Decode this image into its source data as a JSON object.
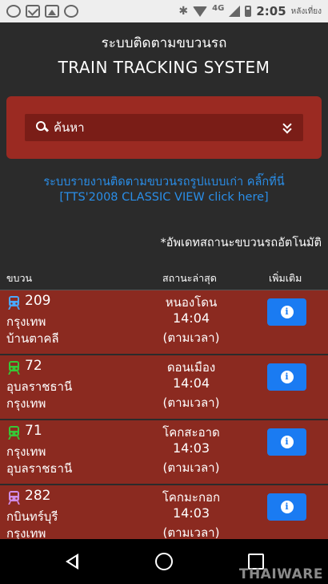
{
  "status_bar": {
    "network": "4G",
    "time": "2:05",
    "period": "หลังเที่ยง"
  },
  "header": {
    "title_th": "ระบบติดตามขบวนรถ",
    "title_en": "TRAIN TRACKING SYSTEM"
  },
  "search": {
    "label": "ค้นหา"
  },
  "classic_link": {
    "line1": "ระบบรายงานติดตามขบวนรถรูปแบบเก่า คลิ๊กที่นี่",
    "line2": "[TTS'2008 CLASSIC VIEW click here]"
  },
  "auto_update_note": "*อัพเดทสถานะขบวนรถอัตโนมัติ",
  "table": {
    "headers": {
      "train": "ขบวน",
      "status": "สถานะล่าสุด",
      "more": "เพิ่มเติม"
    },
    "rows": [
      {
        "number": "209",
        "origin": "กรุงเทพ",
        "destination": "บ้านตาคลี",
        "station": "หนองโดน",
        "time": "14:04",
        "note": "(ตามเวลา)",
        "icon_color": "#4aa8ff"
      },
      {
        "number": "72",
        "origin": "อุบลราชธานี",
        "destination": "กรุงเทพ",
        "station": "ดอนเมือง",
        "time": "14:04",
        "note": "(ตามเวลา)",
        "icon_color": "#37c837"
      },
      {
        "number": "71",
        "origin": "กรุงเทพ",
        "destination": "อุบลราชธานี",
        "station": "โคกสะอาด",
        "time": "14:03",
        "note": "(ตามเวลา)",
        "icon_color": "#37c837"
      },
      {
        "number": "282",
        "origin": "กบินทร์บุรี",
        "destination": "กรุงเทพ",
        "station": "โคกมะกอก",
        "time": "14:03",
        "note": "(ตามเวลา)",
        "icon_color": "#d08ce8"
      }
    ]
  },
  "watermark": "THAIWARE",
  "colors": {
    "background": "#2b2b2b",
    "panel_red": "#9b2a22",
    "row_red": "#8b2a20",
    "link_blue": "#2a8ee8",
    "button_blue": "#1a7bf2"
  }
}
